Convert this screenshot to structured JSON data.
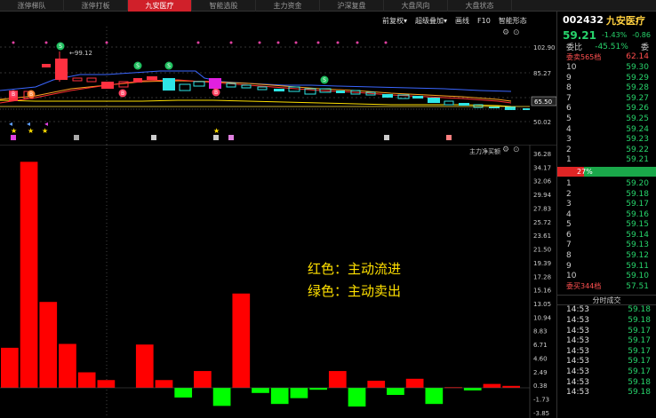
{
  "tabs": [
    {
      "label": "涨停梯队",
      "active": false
    },
    {
      "label": "涨停打板",
      "active": false
    },
    {
      "label": "九安医疗",
      "active": true
    },
    {
      "label": "智能选股",
      "active": false
    },
    {
      "label": "主力资金",
      "active": false
    },
    {
      "label": "沪深复盘",
      "active": false
    },
    {
      "label": "大盘风向",
      "active": false
    },
    {
      "label": "大盘状态",
      "active": false
    }
  ],
  "toolbar": {
    "adjust": "前复权▾",
    "overlay": "超级叠加▾",
    "draw": "画线",
    "f10": "F10",
    "smart": "智能形态"
  },
  "main_chart": {
    "price_labels": [
      "102.90",
      "85.27",
      "65.50",
      "50.02"
    ],
    "price_marker": "←99.12",
    "last_price_tag": "65.50",
    "badge_s": "S",
    "badge_b": "B"
  },
  "flow_chart": {
    "title": "主力净买额",
    "legend_red": "红色：主动流进",
    "legend_green": "绿色：主动卖出",
    "colors": {
      "up": "#ff0000",
      "down": "#00ff00"
    },
    "y_ticks": [
      "36.28",
      "34.17",
      "32.06",
      "29.94",
      "27.83",
      "25.72",
      "23.61",
      "21.50",
      "19.39",
      "17.28",
      "15.16",
      "13.05",
      "10.94",
      "8.83",
      "6.71",
      "4.60",
      "2.49",
      "0.38",
      "-1.73",
      "-3.85"
    ],
    "y_range": [
      -3.85,
      36.28
    ]
  },
  "chart_data": {
    "type": "bar",
    "title": "主力净买额",
    "series": [
      {
        "values": [
          6.2,
          35.0,
          13.3,
          6.8,
          2.4,
          1.2,
          0,
          6.7,
          1.2,
          -1.5,
          2.6,
          -2.8,
          14.6,
          -0.8,
          -2.5,
          -1.6,
          -0.3,
          2.6,
          -2.9,
          1.1,
          -1.1,
          1.4,
          -2.5,
          0.1,
          -0.4,
          0.6,
          0.3
        ]
      }
    ],
    "ylim": [
      -3.85,
      36.28
    ],
    "ylabel": "",
    "xlabel": ""
  },
  "quote": {
    "code": "002432",
    "name": "九安医疗",
    "price": "59.21",
    "pct": "-1.43%",
    "change": "-0.86",
    "weibi_label": "委比",
    "weibi_value": "-45.51%",
    "weicha_label": "委",
    "sell_head": "委卖565档",
    "sell_head_price": "62.14",
    "sells": [
      {
        "lvl": "10",
        "price": "59.30"
      },
      {
        "lvl": "9",
        "price": "59.29"
      },
      {
        "lvl": "8",
        "price": "59.28"
      },
      {
        "lvl": "7",
        "price": "59.27"
      },
      {
        "lvl": "6",
        "price": "59.26"
      },
      {
        "lvl": "5",
        "price": "59.25"
      },
      {
        "lvl": "4",
        "price": "59.24"
      },
      {
        "lvl": "3",
        "price": "59.23"
      },
      {
        "lvl": "2",
        "price": "59.22"
      },
      {
        "lvl": "1",
        "price": "59.21"
      }
    ],
    "ratio_text": "27%",
    "ratio_fraction": 0.27,
    "buys": [
      {
        "lvl": "1",
        "price": "59.20"
      },
      {
        "lvl": "2",
        "price": "59.18"
      },
      {
        "lvl": "3",
        "price": "59.17"
      },
      {
        "lvl": "4",
        "price": "59.16"
      },
      {
        "lvl": "5",
        "price": "59.15"
      },
      {
        "lvl": "6",
        "price": "59.14"
      },
      {
        "lvl": "7",
        "price": "59.13"
      },
      {
        "lvl": "8",
        "price": "59.12"
      },
      {
        "lvl": "9",
        "price": "59.11"
      },
      {
        "lvl": "10",
        "price": "59.10"
      }
    ],
    "buy_head": "委买344档",
    "buy_head_price": "57.51",
    "trades_title": "分时成交",
    "trades": [
      {
        "time": "14:53",
        "price": "59.18"
      },
      {
        "time": "14:53",
        "price": "59.18"
      },
      {
        "time": "14:53",
        "price": "59.17"
      },
      {
        "time": "14:53",
        "price": "59.17"
      },
      {
        "time": "14:53",
        "price": "59.17"
      },
      {
        "time": "14:53",
        "price": "59.17"
      },
      {
        "time": "14:53",
        "price": "59.17"
      },
      {
        "time": "14:53",
        "price": "59.18"
      },
      {
        "time": "14:53",
        "price": "59.18"
      }
    ]
  }
}
